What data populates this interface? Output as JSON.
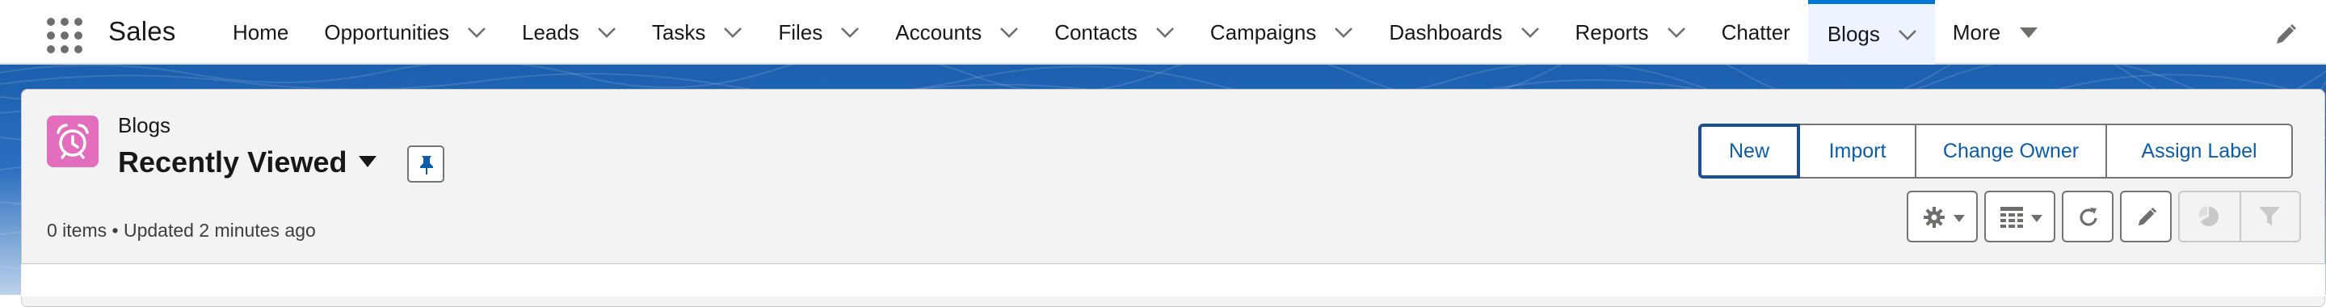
{
  "app": {
    "name": "Sales"
  },
  "nav": {
    "items": [
      {
        "label": "Home",
        "has_menu": false,
        "active": false
      },
      {
        "label": "Opportunities",
        "has_menu": true,
        "active": false
      },
      {
        "label": "Leads",
        "has_menu": true,
        "active": false
      },
      {
        "label": "Tasks",
        "has_menu": true,
        "active": false
      },
      {
        "label": "Files",
        "has_menu": true,
        "active": false
      },
      {
        "label": "Accounts",
        "has_menu": true,
        "active": false
      },
      {
        "label": "Contacts",
        "has_menu": true,
        "active": false
      },
      {
        "label": "Campaigns",
        "has_menu": true,
        "active": false
      },
      {
        "label": "Dashboards",
        "has_menu": true,
        "active": false
      },
      {
        "label": "Reports",
        "has_menu": true,
        "active": false
      },
      {
        "label": "Chatter",
        "has_menu": false,
        "active": false
      },
      {
        "label": "Blogs",
        "has_menu": true,
        "active": true
      },
      {
        "label": "More",
        "has_menu": false,
        "active": false
      }
    ],
    "edit_icon": "pencil-icon",
    "app_launcher_icon": "waffle-icon"
  },
  "list_view": {
    "object_label": "Blogs",
    "object_icon": "alarm-clock-icon",
    "object_icon_color": "#e36ebe",
    "title": "Recently Viewed",
    "pin_icon": "pin-icon",
    "meta": "0 items • Updated 2 minutes ago"
  },
  "actions": {
    "new": "New",
    "import": "Import",
    "change_owner": "Change Owner",
    "assign_label": "Assign Label"
  },
  "toolbar": {
    "settings_icon": "gear-icon",
    "display_as_icon": "table-icon",
    "refresh_icon": "refresh-icon",
    "edit_icon": "pencil-icon",
    "charts_icon": "pie-chart-icon",
    "filter_icon": "filter-icon"
  },
  "colors": {
    "brand_blue": "#0176d3",
    "link_blue": "#0b5cab",
    "band_blue": "#1b5fae"
  }
}
